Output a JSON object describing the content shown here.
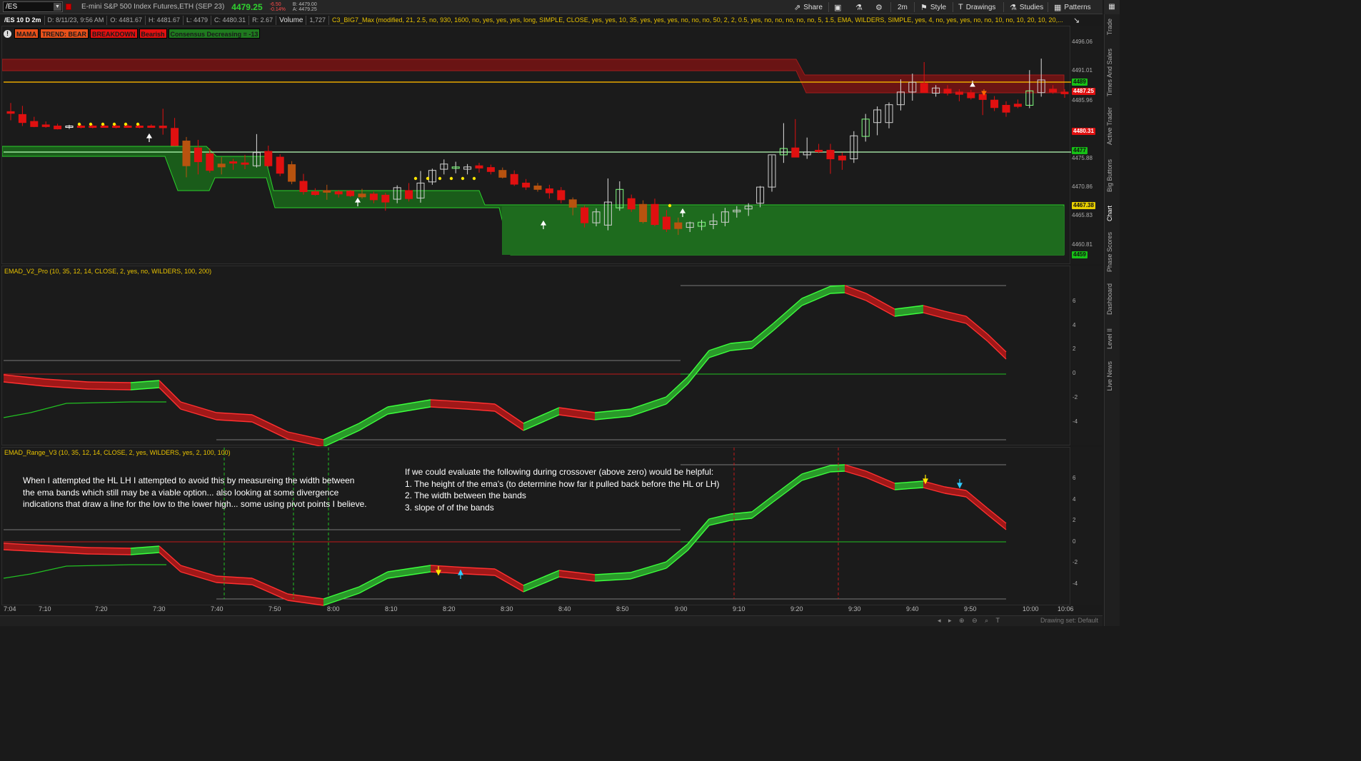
{
  "toolbar": {
    "symbol": "/ES",
    "instrument": "E-mini S&P 500 Index Futures,ETH (SEP 23)",
    "last_price": "4479.25",
    "net_change": "-6.50",
    "net_change_pct": "-0.14%",
    "bid": "B: 4479.00",
    "ask": "A: 4479.25",
    "share_label": "Share",
    "timeframe_label": "2m",
    "style_label": "Style",
    "drawings_label": "Drawings",
    "studies_label": "Studies",
    "patterns_label": "Patterns"
  },
  "infobar": {
    "symbol": "/ES 10 D 2m",
    "date": "D: 8/11/23, 9:56 AM",
    "open": "O: 4481.67",
    "high": "H: 4481.67",
    "low": "L: 4479",
    "close": "C: 4480.31",
    "range": "R: 2.67",
    "volume_label": "Volume",
    "volume": "1,727",
    "study": "C3_BIG7_Max (modified, 21, 2.5, no, 930, 1600, no, yes, yes, yes, long, SIMPLE, CLOSE, yes, yes, 10, 35, yes, yes, yes, no, no, no, 50, 2, 2, 0.5, yes, no, no, no, no, no, 5, 1.5, EMA, WILDERS, SIMPLE, yes, 4, no, yes, yes, no, no, 10, no, 10, 20, 10, 20,..."
  },
  "badges": [
    {
      "text": "MAMA",
      "bg": "#e8501a",
      "fg": "#1a1a1a"
    },
    {
      "text": "TREND: BEAR",
      "bg": "#e8501a",
      "fg": "#1a1a1a"
    },
    {
      "text": "BREAKDOWN",
      "bg": "#e01010",
      "fg": "#1a1a1a"
    },
    {
      "text": "Bearish",
      "bg": "#e01010",
      "fg": "#1a1a1a"
    },
    {
      "text": "Consensus Decreasing = -13",
      "bg": "#1f7a1f",
      "fg": "#1a1a1a"
    }
  ],
  "price_axis": {
    "ticks": [
      "4496.06",
      "4491.01",
      "4485.96",
      "4475.88",
      "4470.86",
      "4465.83",
      "4460.81"
    ],
    "tags": [
      {
        "text": "4489",
        "bg": "#16c016",
        "fg": "#111"
      },
      {
        "text": "4487.25",
        "bg": "#e01010",
        "fg": "#fff"
      },
      {
        "text": "4480.31",
        "bg": "#e01010",
        "fg": "#fff"
      },
      {
        "text": "4477",
        "bg": "#16c016",
        "fg": "#111"
      },
      {
        "text": "4467.38",
        "bg": "#e8d000",
        "fg": "#111"
      },
      {
        "text": "4459",
        "bg": "#16c016",
        "fg": "#111"
      }
    ]
  },
  "emad1": {
    "label": "EMAD_V2_Pro (10, 35, 12, 14, CLOSE, 2, yes, no, WILDERS, 100, 200)",
    "ticks": [
      "6",
      "4",
      "2",
      "0",
      "-2",
      "-4"
    ]
  },
  "emad2": {
    "label": "EMAD_Range_V3 (10, 35, 12, 14, CLOSE, 2, yes, WILDERS, yes, 2, 100, 100)",
    "ticks": [
      "6",
      "4",
      "2",
      "0",
      "-2",
      "-4"
    ],
    "note_left": "When I attempted the HL LH I attempted to avoid this by measureing the width between\nthe ema bands which still may be a viable option... also looking at some divergence\nindications that draw a line for the low to the lower high... some using pivot points I believe.",
    "note_right": "If we could evaluate the following during crossover (above zero) would be helpful:\n1. The height of the ema's (to determine how far it pulled back before the HL or LH)\n2. The width between the bands\n3. slope of of the bands"
  },
  "time_axis": [
    "7:04",
    "7:10",
    "7:20",
    "7:30",
    "7:40",
    "7:50",
    "8:00",
    "8:10",
    "8:20",
    "8:30",
    "8:40",
    "8:50",
    "9:00",
    "9:10",
    "9:20",
    "9:30",
    "9:40",
    "9:50",
    "10:00",
    "10:06"
  ],
  "side_tabs": [
    "Trade",
    "Times And Sales",
    "Active Trader",
    "Big Buttons",
    "Chart",
    "Phase Scores",
    "Dashboard",
    "Level II",
    "Live News"
  ],
  "bottom": {
    "drawing_set": "Drawing set: Default"
  },
  "colors": {
    "bull": "#22c022",
    "bear": "#e01010",
    "accent": "#e8c200"
  }
}
